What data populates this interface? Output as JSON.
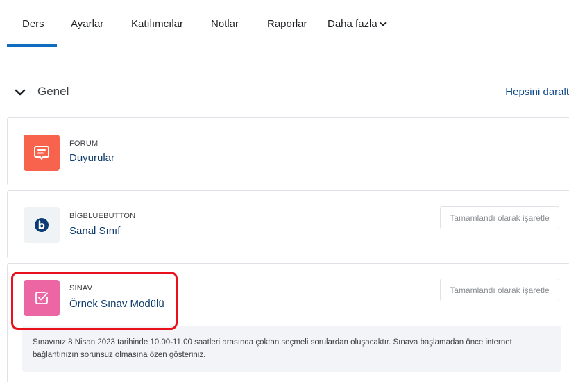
{
  "nav": {
    "tabs": [
      {
        "label": "Ders"
      },
      {
        "label": "Ayarlar"
      },
      {
        "label": "Katılımcılar"
      },
      {
        "label": "Notlar"
      },
      {
        "label": "Raporlar"
      },
      {
        "label": "Daha fazla"
      }
    ]
  },
  "section": {
    "title": "Genel",
    "collapse_all": "Hepsini daralt"
  },
  "activities": [
    {
      "type": "FORUM",
      "name": "Duyurular",
      "icon": "forum-icon",
      "color": "#f7634d"
    },
    {
      "type": "BİGBLUEBUTTON",
      "name": "Sanal Sınıf",
      "icon": "bigbluebutton-icon",
      "complete_label": "Tamamlandı olarak işaretle"
    },
    {
      "type": "SINAV",
      "name": "Örnek Sınav Modülü",
      "icon": "quiz-icon",
      "color": "#eb66a2",
      "complete_label": "Tamamlandı olarak işaretle",
      "description": "Sınavınız 8 Nisan 2023 tarihinde 10.00-11.00 saatleri arasında çoktan seçmeli sorulardan oluşacaktır. Sınava başlamadan önce internet bağlantınızın sorunsuz olmasına özen gösteriniz."
    }
  ],
  "colors": {
    "accent": "#0f6cbf",
    "highlight": "#e8101a",
    "link": "#0f3d6e"
  }
}
